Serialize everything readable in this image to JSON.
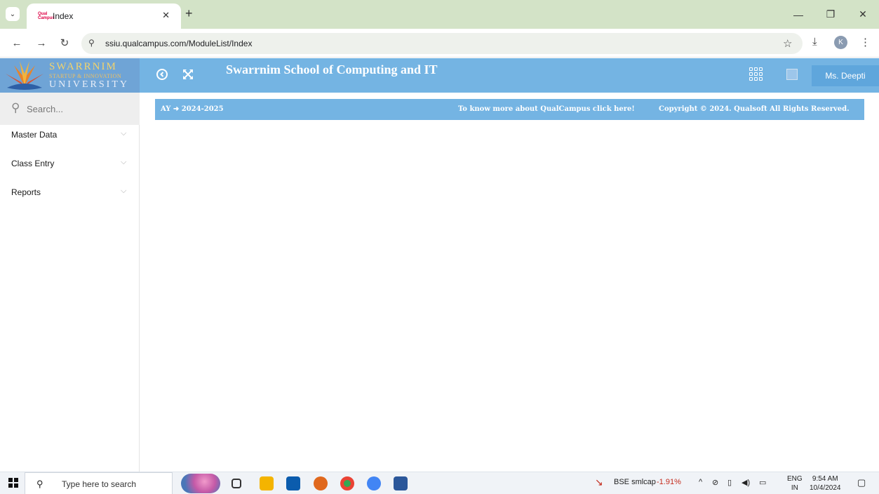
{
  "browser": {
    "tab_title": "Index",
    "tab_favicon_text": "Qual Campus",
    "url": "ssiu.qualcampus.com/ModuleList/Index"
  },
  "logo": {
    "line1": "SWARRNIM",
    "line2": "STARTUP & INNOVATION",
    "line3": "UNIVERSITY"
  },
  "header": {
    "title": "Swarrnim School of Computing and IT",
    "user_name": "Ms. Deepti"
  },
  "sidebar": {
    "search_placeholder": "Search...",
    "items": [
      {
        "label": "Master Data"
      },
      {
        "label": "Class Entry"
      },
      {
        "label": "Reports"
      }
    ]
  },
  "infobar": {
    "ay_label": "AY",
    "ay_value": "2024-2025",
    "link_text": "To know more about QualCampus click here!",
    "copyright": "Copyright © 2024. Qualsoft All Rights Reserved."
  },
  "taskbar": {
    "search_placeholder": "Type here to search",
    "stock_name": "BSE smlcap",
    "stock_change": "-1.91%",
    "lang_top": "ENG",
    "lang_bottom": "IN",
    "time": "9:54 AM",
    "date": "10/4/2024"
  },
  "colors": {
    "header_blue": "#74b4e3",
    "tabstrip_green": "#d3e3c7",
    "stock_red": "#c42b1c"
  }
}
